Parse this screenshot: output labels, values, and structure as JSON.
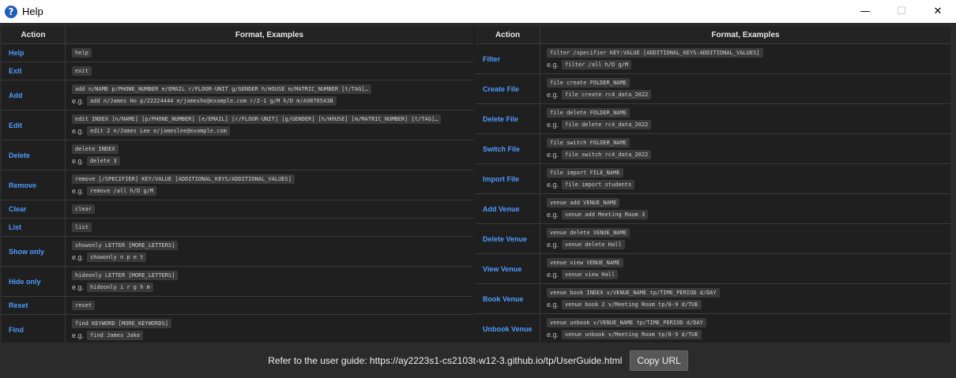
{
  "window": {
    "title": "Help",
    "app_icon": "?",
    "minimize_glyph": "—",
    "maximize_glyph": "☐",
    "close_glyph": "✕"
  },
  "left_table": {
    "headers": [
      "Action",
      "Format, Examples"
    ],
    "rows": [
      {
        "action": "Help",
        "format": "help"
      },
      {
        "action": "Exit",
        "format": "exit"
      },
      {
        "action": "Add",
        "format": "add n/NAME p/PHONE_NUMBER e/EMAIL r/FLOOR-UNIT g/GENDER h/HOUSE m/MATRIC_NUMBER [t/TAG]…",
        "example": "add n/James Ho p/22224444 e/jamesho@example.com r/2-1 g/M h/D m/A9876543B"
      },
      {
        "action": "Edit",
        "format": "edit INDEX [n/NAME] [p/PHONE_NUMBER] [e/EMAIL] [r/FLOOR-UNIT] [g/GENDER] [h/HOUSE] [m/MATRIC_NUMBER] [t/TAG]…",
        "example": "edit 2 n/James Lee e/jameslee@example.com"
      },
      {
        "action": "Delete",
        "format": "delete INDEX",
        "example": "delete 3"
      },
      {
        "action": "Remove",
        "format": "remove [/SPECIFIER] KEY/VALUE [ADDITIONAL_KEYS/ADDITIONAL_VALUES]",
        "example": "remove /all h/D g/M"
      },
      {
        "action": "Clear",
        "format": "clear"
      },
      {
        "action": "List",
        "format": "list"
      },
      {
        "action": "Show only",
        "format": "showonly LETTER [MORE_LETTERS]",
        "example": "showonly n p e t"
      },
      {
        "action": "Hide only",
        "format": "hideonly LETTER [MORE_LETTERS]",
        "example": "hideonly i r g h m"
      },
      {
        "action": "Reset",
        "format": "reset"
      },
      {
        "action": "Find",
        "format": "find KEYWORD [MORE_KEYWORDS]",
        "example": "find James Jake"
      }
    ]
  },
  "right_table": {
    "headers": [
      "Action",
      "Format, Examples"
    ],
    "rows": [
      {
        "action": "Filter",
        "format": "filter /specifier KEY:VALUE [ADDITIONAL_KEYS:ADDITIONAL_VALUES]",
        "example": "filter /all h/D g/M"
      },
      {
        "action": "Create File",
        "format": "file create FOLDER_NAME",
        "example": "file create rc4_data_2022"
      },
      {
        "action": "Delete File",
        "format": "file delete FOLDER_NAME",
        "example": "file delete rc4_data_2022"
      },
      {
        "action": "Switch File",
        "format": "file switch FOLDER_NAME",
        "example": "file switch rc4_data_2022"
      },
      {
        "action": "Import File",
        "format": "file import FILE_NAME",
        "example": "file import students"
      },
      {
        "action": "Add Venue",
        "format": "venue add VENUE_NAME",
        "example": "venue add Meeting Room 3"
      },
      {
        "action": "Delete Venue",
        "format": "venue delete VENUE_NAME",
        "example": "venue delete Hall"
      },
      {
        "action": "View Venue",
        "format": "venue view VENUE_NAME",
        "example": "venue view Hall"
      },
      {
        "action": "Book Venue",
        "format": "venue book INDEX v/VENUE_NAME tp/TIME_PERIOD d/DAY",
        "example": "venue book 2 v/Meeting Room tp/8-9 d/TUE"
      },
      {
        "action": "Unbook Venue",
        "format": "venue unbook v/VENUE_NAME tp/TIME_PERIOD d/DAY",
        "example": "venue unbook v/Meeting Room tp/8-9 d/TUE"
      }
    ]
  },
  "eg_label": "e.g.",
  "footer": {
    "guide_text": "Refer to the user guide: https://ay2223s1-cs2103t-w12-3.github.io/tp/UserGuide.html",
    "copy_button": "Copy URL"
  }
}
